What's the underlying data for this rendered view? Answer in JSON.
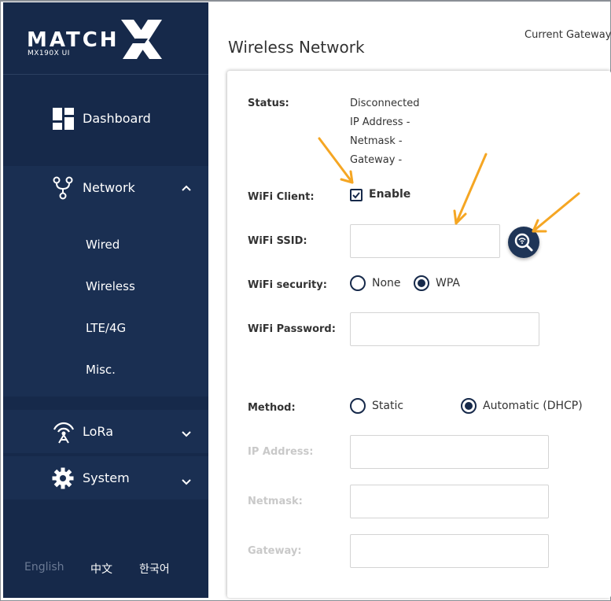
{
  "brand": {
    "name": "MATCH",
    "subtitle": "MX190X UI"
  },
  "sidebar": {
    "items": [
      {
        "label": "Dashboard",
        "icon": "dashboard-icon"
      },
      {
        "label": "Network",
        "icon": "network-icon",
        "expanded": true,
        "children": [
          {
            "label": "Wired"
          },
          {
            "label": "Wireless"
          },
          {
            "label": "LTE/4G"
          },
          {
            "label": "Misc."
          }
        ]
      },
      {
        "label": "LoRa",
        "icon": "lora-antenna-icon",
        "expanded": false
      },
      {
        "label": "System",
        "icon": "gear-icon",
        "expanded": false
      }
    ]
  },
  "languages": [
    {
      "label": "English",
      "active": false
    },
    {
      "label": "中文",
      "active": true
    },
    {
      "label": "한국어",
      "active": true
    }
  ],
  "page": {
    "title": "Wireless Network",
    "gateway_label": "Current Gateway"
  },
  "form": {
    "status": {
      "label": "Status:",
      "lines": [
        "Disconnected",
        "IP Address -",
        "Netmask -",
        "Gateway -"
      ]
    },
    "wifi_client": {
      "label": "WiFi Client:",
      "checkbox_label": "Enable",
      "checked": true
    },
    "wifi_ssid": {
      "label": "WiFi SSID:",
      "value": ""
    },
    "wifi_security": {
      "label": "WiFi security:",
      "options": [
        "None",
        "WPA"
      ],
      "selected": "WPA"
    },
    "wifi_password": {
      "label": "WiFi Password:",
      "value": ""
    },
    "method": {
      "label": "Method:",
      "options": [
        "Static",
        "Automatic (DHCP)"
      ],
      "selected": "Automatic (DHCP)"
    },
    "ip_address": {
      "label": "IP Address:",
      "value": ""
    },
    "netmask": {
      "label": "Netmask:",
      "value": ""
    },
    "gateway": {
      "label": "Gateway:",
      "value": ""
    }
  },
  "colors": {
    "sidebar_bg": "#16294a",
    "sidebar_active_bg": "#1a2f52",
    "accent": "#16294a",
    "annotation_arrow": "#f5a623",
    "disabled_label": "#c9c9c9"
  }
}
